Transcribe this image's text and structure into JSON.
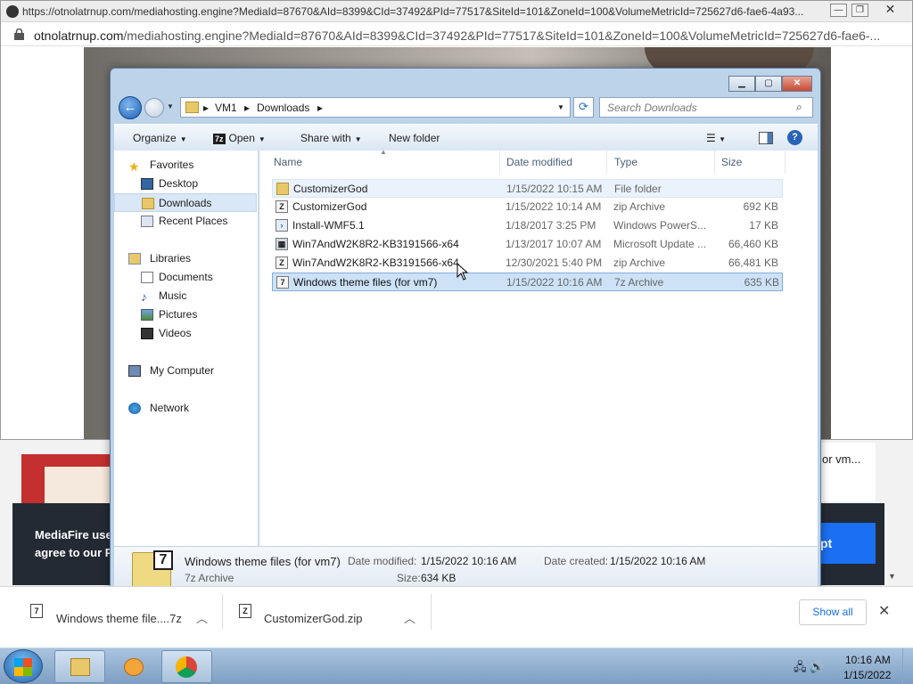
{
  "popup": {
    "title": "https://otnolatrnup.com/mediahosting.engine?MediaId=87670&AId=8399&CId=37492&PId=77517&SiteId=101&ZoneId=100&VolumeMetricId=725627d6-fae6-4a93...",
    "address_domain": "otnolatrnup.com",
    "address_path": "/mediahosting.engine?MediaId=87670&AId=8399&CId=37492&PId=77517&SiteId=101&ZoneId=100&VolumeMetricId=725627d6-fae6-..."
  },
  "page": {
    "right_text": "or vm...",
    "cookie_line1": "MediaFire use",
    "cookie_line2": "agree to our P",
    "accept_partial": "pt"
  },
  "explorer": {
    "breadcrumb": [
      "VM1",
      "Downloads"
    ],
    "search_placeholder": "Search Downloads",
    "toolbar": {
      "organize": "Organize",
      "open": "Open",
      "open_badge": "7z",
      "share_with": "Share with",
      "new_folder": "New folder"
    },
    "nav": {
      "favorites": "Favorites",
      "desktop": "Desktop",
      "downloads": "Downloads",
      "recent_places": "Recent Places",
      "libraries": "Libraries",
      "documents": "Documents",
      "music": "Music",
      "pictures": "Pictures",
      "videos": "Videos",
      "my_computer": "My Computer",
      "network": "Network"
    },
    "columns": {
      "name": "Name",
      "date": "Date modified",
      "type": "Type",
      "size": "Size"
    },
    "files": [
      {
        "name": "CustomizerGod",
        "date": "1/15/2022 10:15 AM",
        "type": "File folder",
        "size": "",
        "icon": "folder-icon"
      },
      {
        "name": "CustomizerGod",
        "date": "1/15/2022 10:14 AM",
        "type": "zip Archive",
        "size": "692 KB",
        "icon": "zip-archive-icon"
      },
      {
        "name": "Install-WMF5.1",
        "date": "1/18/2017 3:25 PM",
        "type": "Windows PowerS...",
        "size": "17 KB",
        "icon": "powershell-script-icon"
      },
      {
        "name": "Win7AndW2K8R2-KB3191566-x64",
        "date": "1/13/2017 10:07 AM",
        "type": "Microsoft Update ...",
        "size": "66,460 KB",
        "icon": "update-package-icon"
      },
      {
        "name": "Win7AndW2K8R2-KB3191566-x64",
        "date": "12/30/2021 5:40 PM",
        "type": "zip Archive",
        "size": "66,481 KB",
        "icon": "zip-archive-icon"
      },
      {
        "name": "Windows theme files (for vm7)",
        "date": "1/15/2022 10:16 AM",
        "type": "7z Archive",
        "size": "635 KB",
        "icon": "7z-archive-icon"
      }
    ],
    "details": {
      "name": "Windows theme files (for vm7)",
      "type": "7z Archive",
      "modified_label": "Date modified:",
      "modified_value": "1/15/2022 10:16 AM",
      "created_label": "Date created:",
      "created_value": "1/15/2022 10:16 AM",
      "size_label": "Size:",
      "size_value": "634 KB"
    }
  },
  "downloads_bar": {
    "items": [
      {
        "name": "Windows theme file....7z"
      },
      {
        "name": "CustomizerGod.zip"
      }
    ],
    "show_all": "Show all"
  },
  "taskbar": {
    "time": "10:16 AM",
    "date": "1/15/2022"
  }
}
